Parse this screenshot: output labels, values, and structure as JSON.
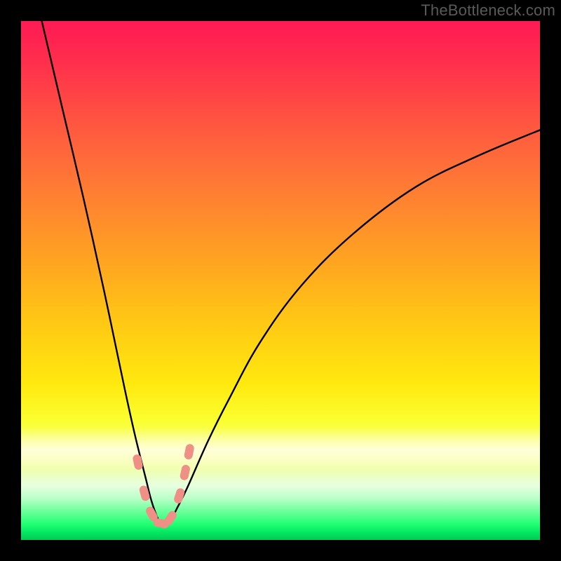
{
  "watermark": "TheBottleneck.com",
  "chart_data": {
    "type": "line",
    "title": "",
    "xlabel": "",
    "ylabel": "",
    "xlim": [
      0,
      100
    ],
    "ylim": [
      0,
      100
    ],
    "background_gradient": {
      "top": "#ff1a54",
      "mid_upper": "#ff8a2e",
      "mid": "#ffe90f",
      "mid_lower": "#f5ff6e",
      "green": "#04e862"
    },
    "curve": {
      "description": "Absolute-value style V curve with rounded trough; left branch steep, right branch tending toward ~80% height at right edge; trough near x≈27, y≈3.",
      "x": [
        4,
        8,
        12,
        16,
        20,
        22,
        24,
        25,
        26,
        27,
        28,
        29,
        30,
        32,
        36,
        40,
        46,
        54,
        64,
        76,
        88,
        100
      ],
      "y": [
        100,
        83,
        66,
        48,
        29,
        20,
        12,
        8,
        5,
        3,
        3,
        4,
        6,
        10,
        19,
        27,
        38,
        49,
        59,
        68,
        74,
        79
      ]
    },
    "trough_markers": {
      "points": [
        {
          "x": 22.5,
          "y": 15
        },
        {
          "x": 23.8,
          "y": 9
        },
        {
          "x": 25.2,
          "y": 5
        },
        {
          "x": 27.0,
          "y": 3.2
        },
        {
          "x": 28.8,
          "y": 4.2
        },
        {
          "x": 30.5,
          "y": 8.5
        },
        {
          "x": 31.6,
          "y": 13
        },
        {
          "x": 32.4,
          "y": 17
        }
      ],
      "color": "#ef8f86"
    }
  }
}
